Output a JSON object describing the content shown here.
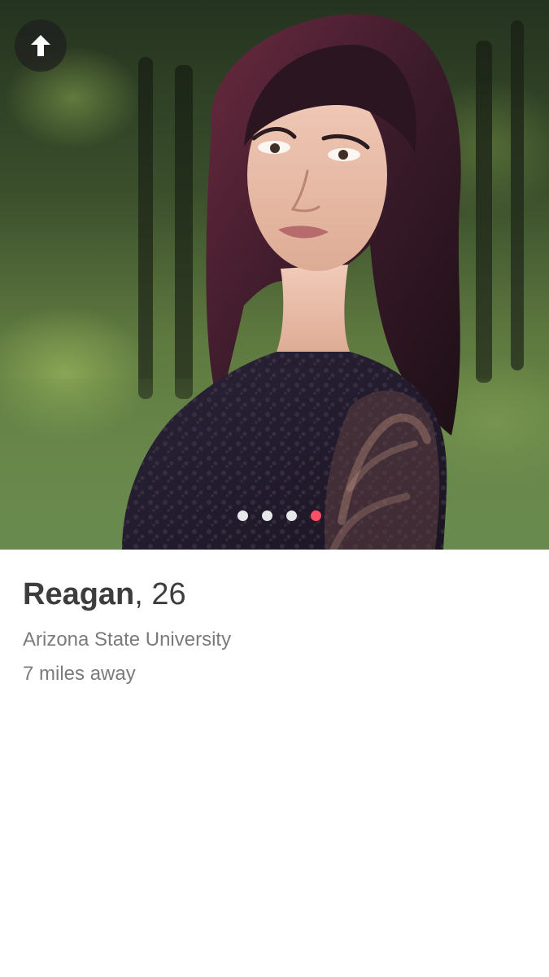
{
  "profile": {
    "name": "Reagan",
    "separator": ",",
    "age": "26",
    "school": "Arizona State University",
    "distance": "7 miles away"
  },
  "photo_carousel": {
    "photo_count": 4,
    "active_index": 3,
    "dot_color": "#e7e8ec",
    "active_dot_color": "#ff4f68"
  },
  "icons": {
    "up_button_icon": "arrow-up-icon"
  }
}
